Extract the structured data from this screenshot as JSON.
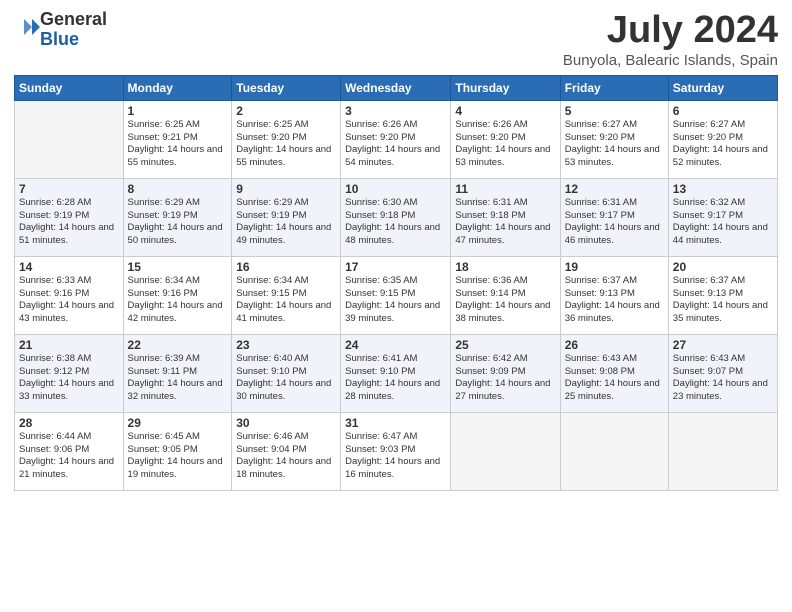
{
  "logo": {
    "general": "General",
    "blue": "Blue"
  },
  "title": "July 2024",
  "subtitle": "Bunyola, Balearic Islands, Spain",
  "days_of_week": [
    "Sunday",
    "Monday",
    "Tuesday",
    "Wednesday",
    "Thursday",
    "Friday",
    "Saturday"
  ],
  "weeks": [
    [
      {
        "day": "",
        "sunrise": "",
        "sunset": "",
        "daylight": ""
      },
      {
        "day": "1",
        "sunrise": "Sunrise: 6:25 AM",
        "sunset": "Sunset: 9:21 PM",
        "daylight": "Daylight: 14 hours and 55 minutes."
      },
      {
        "day": "2",
        "sunrise": "Sunrise: 6:25 AM",
        "sunset": "Sunset: 9:20 PM",
        "daylight": "Daylight: 14 hours and 55 minutes."
      },
      {
        "day": "3",
        "sunrise": "Sunrise: 6:26 AM",
        "sunset": "Sunset: 9:20 PM",
        "daylight": "Daylight: 14 hours and 54 minutes."
      },
      {
        "day": "4",
        "sunrise": "Sunrise: 6:26 AM",
        "sunset": "Sunset: 9:20 PM",
        "daylight": "Daylight: 14 hours and 53 minutes."
      },
      {
        "day": "5",
        "sunrise": "Sunrise: 6:27 AM",
        "sunset": "Sunset: 9:20 PM",
        "daylight": "Daylight: 14 hours and 53 minutes."
      },
      {
        "day": "6",
        "sunrise": "Sunrise: 6:27 AM",
        "sunset": "Sunset: 9:20 PM",
        "daylight": "Daylight: 14 hours and 52 minutes."
      }
    ],
    [
      {
        "day": "7",
        "sunrise": "Sunrise: 6:28 AM",
        "sunset": "Sunset: 9:19 PM",
        "daylight": "Daylight: 14 hours and 51 minutes."
      },
      {
        "day": "8",
        "sunrise": "Sunrise: 6:29 AM",
        "sunset": "Sunset: 9:19 PM",
        "daylight": "Daylight: 14 hours and 50 minutes."
      },
      {
        "day": "9",
        "sunrise": "Sunrise: 6:29 AM",
        "sunset": "Sunset: 9:19 PM",
        "daylight": "Daylight: 14 hours and 49 minutes."
      },
      {
        "day": "10",
        "sunrise": "Sunrise: 6:30 AM",
        "sunset": "Sunset: 9:18 PM",
        "daylight": "Daylight: 14 hours and 48 minutes."
      },
      {
        "day": "11",
        "sunrise": "Sunrise: 6:31 AM",
        "sunset": "Sunset: 9:18 PM",
        "daylight": "Daylight: 14 hours and 47 minutes."
      },
      {
        "day": "12",
        "sunrise": "Sunrise: 6:31 AM",
        "sunset": "Sunset: 9:17 PM",
        "daylight": "Daylight: 14 hours and 46 minutes."
      },
      {
        "day": "13",
        "sunrise": "Sunrise: 6:32 AM",
        "sunset": "Sunset: 9:17 PM",
        "daylight": "Daylight: 14 hours and 44 minutes."
      }
    ],
    [
      {
        "day": "14",
        "sunrise": "Sunrise: 6:33 AM",
        "sunset": "Sunset: 9:16 PM",
        "daylight": "Daylight: 14 hours and 43 minutes."
      },
      {
        "day": "15",
        "sunrise": "Sunrise: 6:34 AM",
        "sunset": "Sunset: 9:16 PM",
        "daylight": "Daylight: 14 hours and 42 minutes."
      },
      {
        "day": "16",
        "sunrise": "Sunrise: 6:34 AM",
        "sunset": "Sunset: 9:15 PM",
        "daylight": "Daylight: 14 hours and 41 minutes."
      },
      {
        "day": "17",
        "sunrise": "Sunrise: 6:35 AM",
        "sunset": "Sunset: 9:15 PM",
        "daylight": "Daylight: 14 hours and 39 minutes."
      },
      {
        "day": "18",
        "sunrise": "Sunrise: 6:36 AM",
        "sunset": "Sunset: 9:14 PM",
        "daylight": "Daylight: 14 hours and 38 minutes."
      },
      {
        "day": "19",
        "sunrise": "Sunrise: 6:37 AM",
        "sunset": "Sunset: 9:13 PM",
        "daylight": "Daylight: 14 hours and 36 minutes."
      },
      {
        "day": "20",
        "sunrise": "Sunrise: 6:37 AM",
        "sunset": "Sunset: 9:13 PM",
        "daylight": "Daylight: 14 hours and 35 minutes."
      }
    ],
    [
      {
        "day": "21",
        "sunrise": "Sunrise: 6:38 AM",
        "sunset": "Sunset: 9:12 PM",
        "daylight": "Daylight: 14 hours and 33 minutes."
      },
      {
        "day": "22",
        "sunrise": "Sunrise: 6:39 AM",
        "sunset": "Sunset: 9:11 PM",
        "daylight": "Daylight: 14 hours and 32 minutes."
      },
      {
        "day": "23",
        "sunrise": "Sunrise: 6:40 AM",
        "sunset": "Sunset: 9:10 PM",
        "daylight": "Daylight: 14 hours and 30 minutes."
      },
      {
        "day": "24",
        "sunrise": "Sunrise: 6:41 AM",
        "sunset": "Sunset: 9:10 PM",
        "daylight": "Daylight: 14 hours and 28 minutes."
      },
      {
        "day": "25",
        "sunrise": "Sunrise: 6:42 AM",
        "sunset": "Sunset: 9:09 PM",
        "daylight": "Daylight: 14 hours and 27 minutes."
      },
      {
        "day": "26",
        "sunrise": "Sunrise: 6:43 AM",
        "sunset": "Sunset: 9:08 PM",
        "daylight": "Daylight: 14 hours and 25 minutes."
      },
      {
        "day": "27",
        "sunrise": "Sunrise: 6:43 AM",
        "sunset": "Sunset: 9:07 PM",
        "daylight": "Daylight: 14 hours and 23 minutes."
      }
    ],
    [
      {
        "day": "28",
        "sunrise": "Sunrise: 6:44 AM",
        "sunset": "Sunset: 9:06 PM",
        "daylight": "Daylight: 14 hours and 21 minutes."
      },
      {
        "day": "29",
        "sunrise": "Sunrise: 6:45 AM",
        "sunset": "Sunset: 9:05 PM",
        "daylight": "Daylight: 14 hours and 19 minutes."
      },
      {
        "day": "30",
        "sunrise": "Sunrise: 6:46 AM",
        "sunset": "Sunset: 9:04 PM",
        "daylight": "Daylight: 14 hours and 18 minutes."
      },
      {
        "day": "31",
        "sunrise": "Sunrise: 6:47 AM",
        "sunset": "Sunset: 9:03 PM",
        "daylight": "Daylight: 14 hours and 16 minutes."
      },
      {
        "day": "",
        "sunrise": "",
        "sunset": "",
        "daylight": ""
      },
      {
        "day": "",
        "sunrise": "",
        "sunset": "",
        "daylight": ""
      },
      {
        "day": "",
        "sunrise": "",
        "sunset": "",
        "daylight": ""
      }
    ]
  ]
}
